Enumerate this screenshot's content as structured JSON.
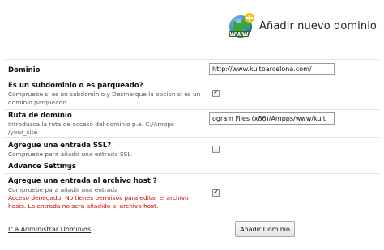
{
  "header": {
    "title": "Añadir nuevo dominio",
    "icon": "globe-www-add-icon"
  },
  "domain": {
    "label": "Dominio",
    "value": "http://www.kultbarcelona.com/"
  },
  "subdomain": {
    "label": "Es un subdominio o es parqueado?",
    "help": "Compruebe si es un subdominio y Desmarque la opcion si es un dominio parqueado",
    "checked": true
  },
  "path": {
    "label": "Ruta de dominio",
    "help": "Introduzca la ruta de acceso del dominio p.e. C:/Ampps /your_site",
    "value": "ogram Files (x86)/Ampps/www/kult"
  },
  "ssl": {
    "label": "Agregue una entrada SSL?",
    "help": "Compruebe para añadir una entrada SSL",
    "checked": false
  },
  "advanced": {
    "label": "Advance Settings"
  },
  "hosts": {
    "label": "Agregue una entrada al archivo host ?",
    "help": "Compruebe para añadir una entrada",
    "error": "Acceso denegado: No tienes permisos para editar el archivo hosts. La entrada no será añadido al archivo host.",
    "checked": true
  },
  "footer": {
    "back_link": "Ir a Administrar Dominios",
    "submit": "Añadir Dominio"
  },
  "colors": {
    "error": "#d60000",
    "title": "#222222"
  }
}
